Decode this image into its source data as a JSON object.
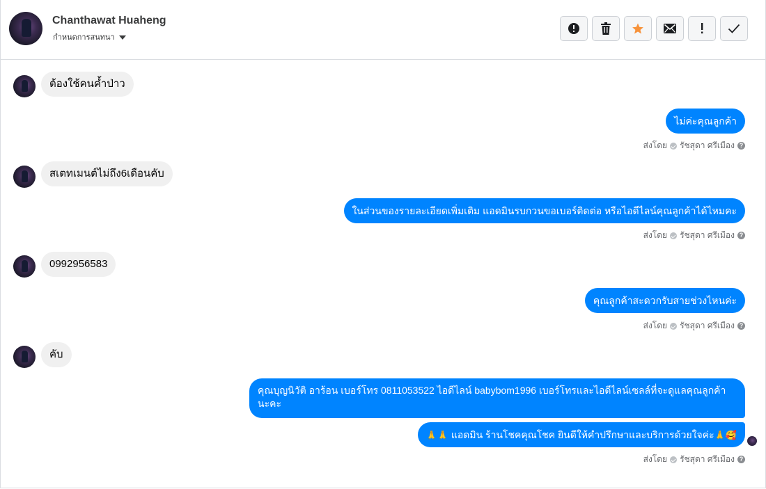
{
  "header": {
    "name": "Chanthawat Huaheng",
    "subtitle": "กำหนดการสนทนา",
    "actions": [
      {
        "name": "report-button",
        "icon": "alert-circle-icon"
      },
      {
        "name": "delete-button",
        "icon": "trash-icon"
      },
      {
        "name": "star-button",
        "icon": "star-icon",
        "color": "#f7923a"
      },
      {
        "name": "mark-unread-button",
        "icon": "envelope-icon"
      },
      {
        "name": "mark-important-button",
        "icon": "exclamation-icon"
      },
      {
        "name": "mark-done-button",
        "icon": "check-icon"
      }
    ]
  },
  "messages": {
    "m1": "ต้องใช้คนค้ำป่าว",
    "m2": "ไม่ค่ะคุณลูกค้า",
    "m3": "สเตทเมนต์ไม่ถึง6เดือนคับ",
    "m4": "ในส่วนของรายละเอียดเพิ่มเติม แอดมินรบกวนขอเบอร์ติดต่อ หรือไอดีไลน์คุณลูกค้าได้ไหมคะ",
    "m5": "0992956583",
    "m6": "คุณลูกค้าสะดวกรับสายช่วงไหนค่ะ",
    "m7": "คับ",
    "m8": "คุณบุญนิวัติ  อาร้อน        เบอร์โทร 0811053522  ไอดีไลน์ babybom1996   เบอร์โทรและไอดีไลน์เซลล์ที่จะดูแลคุณลูกค้านะคะ",
    "m9": "แอดมิน ร้านโชคคุณโชค ยินดีให้คำปรึกษาและบริการด้วยใจค่ะ"
  },
  "sent_by": {
    "prefix": "ส่งโดย",
    "agent": "รัชสุดา ศรีเมือง",
    "help": "?"
  },
  "emoji": {
    "pray": "🙏",
    "love": "🥰"
  },
  "colors": {
    "outgoing": "#0084ff",
    "incoming": "#f0f0f0"
  }
}
